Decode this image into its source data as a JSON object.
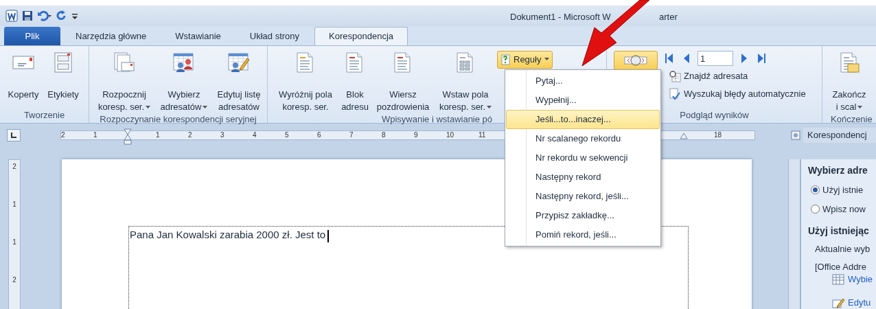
{
  "title_bar": {
    "title": "Dokument1  -  Microsoft W",
    "title_tail": "arter"
  },
  "tabs": [
    {
      "label": "Plik",
      "kind": "file",
      "selected": false
    },
    {
      "label": "Narzędzia główne",
      "kind": "tab",
      "selected": false
    },
    {
      "label": "Wstawianie",
      "kind": "tab",
      "selected": false
    },
    {
      "label": "Układ strony",
      "kind": "tab",
      "selected": false
    },
    {
      "label": "Korespondencja",
      "kind": "tab",
      "selected": true
    }
  ],
  "ribbon_groups": [
    {
      "label": "Tworzenie",
      "buttons": [
        {
          "lines": [
            "Koperty"
          ],
          "kind": "envelope",
          "dropdown": false
        },
        {
          "lines": [
            "Etykiety"
          ],
          "kind": "labels",
          "dropdown": false
        }
      ]
    },
    {
      "label": "Rozpoczynanie korespondencji seryjnej",
      "buttons": [
        {
          "lines": [
            "Rozpocznij",
            "koresp. ser."
          ],
          "kind": "stack",
          "dropdown": true
        },
        {
          "lines": [
            "Wybierz",
            "adresatów"
          ],
          "kind": "people",
          "dropdown": true
        },
        {
          "lines": [
            "Edytuj listę",
            "adresatów"
          ],
          "kind": "edit-list",
          "dropdown": false
        }
      ]
    },
    {
      "label": "Wpisywanie i wstawianie pó",
      "buttons": [
        {
          "lines": [
            "Wyróżnij pola",
            "koresp. ser."
          ],
          "kind": "highlight-doc",
          "dropdown": false
        },
        {
          "lines": [
            "Blok",
            "adresu"
          ],
          "kind": "block-doc",
          "dropdown": false
        },
        {
          "lines": [
            "Wiersz",
            "pozdrowienia"
          ],
          "kind": "greeting-doc",
          "dropdown": false
        },
        {
          "lines": [
            "Wstaw pola",
            "koresp. ser."
          ],
          "kind": "table-doc",
          "dropdown": true
        }
      ],
      "rules_button": {
        "label": "Reguły",
        "pressed": true
      }
    }
  ],
  "preview": {
    "label": "Podgląd wyników",
    "preview_button": {
      "pressed": true
    },
    "record": "1",
    "actions": [
      {
        "label": "Znajdź adresata",
        "kind": "find"
      },
      {
        "label": "Wyszukaj błędy automatycznie",
        "kind": "check"
      }
    ]
  },
  "finish": {
    "label": "Kończenie",
    "button": {
      "lines": [
        "Zakończ",
        "i scal"
      ],
      "dropdown": true
    }
  },
  "rules_menu": [
    {
      "label": "Pytaj...",
      "selected": false
    },
    {
      "label": "Wypełnij...",
      "selected": false
    },
    {
      "label": "Jeśli...to...inaczej...",
      "selected": true
    },
    {
      "label": "Nr scalanego rekordu",
      "selected": false
    },
    {
      "label": "Nr rekordu w sekwencji",
      "selected": false
    },
    {
      "label": "Następny rekord",
      "selected": false
    },
    {
      "label": "Następny rekord, jeśli...",
      "selected": false
    },
    {
      "label": "Przypisz zakładkę...",
      "selected": false
    },
    {
      "label": "Pomiń rekord, jeśli...",
      "selected": false
    }
  ],
  "ruler": {
    "left_labels": [
      "2",
      "1"
    ],
    "right_labels": [
      "1",
      "2",
      "3",
      "4",
      "5",
      "6",
      "7",
      "8",
      "9",
      "10",
      "11"
    ],
    "far_label": "18"
  },
  "vertical_ruler": [
    "2",
    "1",
    "1",
    "2"
  ],
  "document": {
    "text": "Pana Jan Kowalski zarabia 2000  zł. Jest to"
  },
  "task_pane": {
    "title": "Korespondencj",
    "section1": "Wybierz adre",
    "options": [
      {
        "label": "Użyj istnie",
        "selected": true
      },
      {
        "label": "Wpisz now",
        "selected": false
      }
    ],
    "section2": "Użyj istniejąc",
    "current": "Aktualnie wyb",
    "source": "[Office Addre",
    "links": [
      {
        "label": "Wybie",
        "kind": "table"
      },
      {
        "label": "Edytu",
        "kind": "edit"
      }
    ]
  }
}
